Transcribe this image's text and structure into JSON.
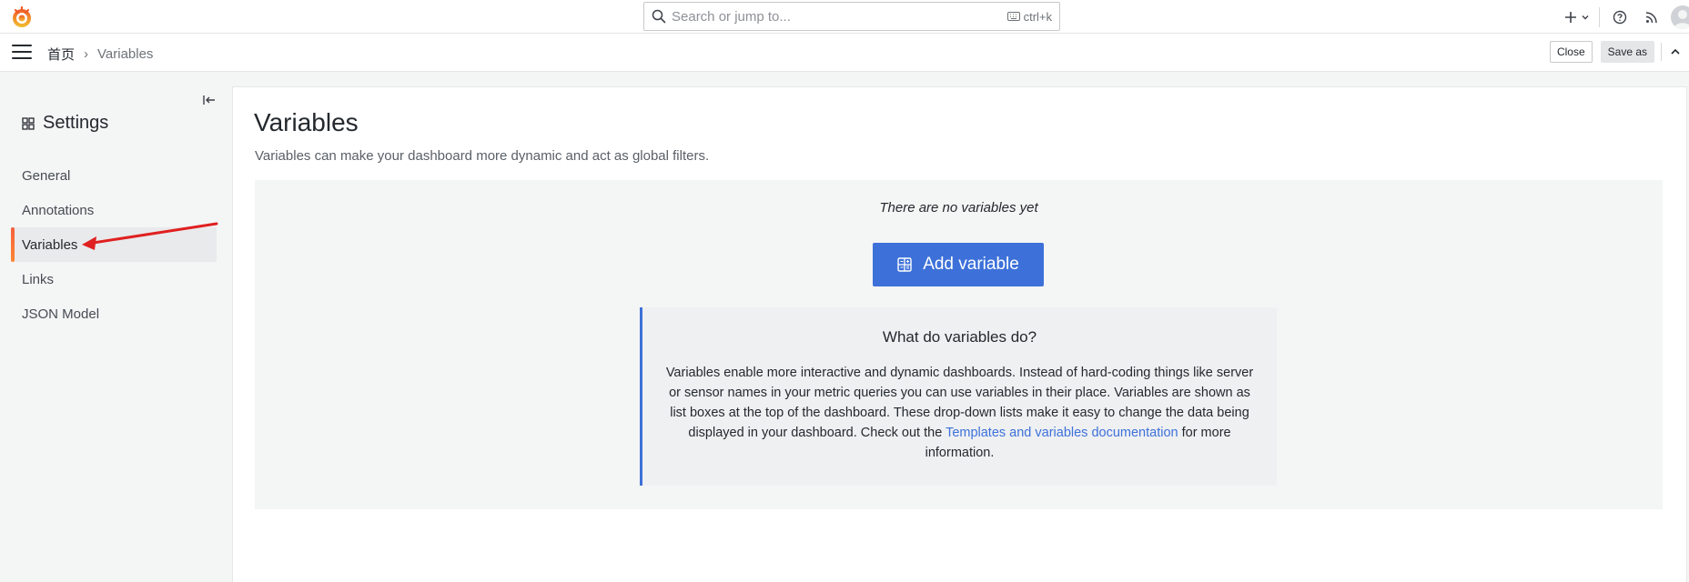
{
  "topbar": {
    "search_placeholder": "Search or jump to...",
    "search_shortcut": "ctrl+k"
  },
  "subbar": {
    "breadcrumb_home": "首页",
    "breadcrumb_sep": "›",
    "breadcrumb_current": "Variables",
    "close_label": "Close",
    "save_as_label": "Save as"
  },
  "sidebar": {
    "title": "Settings",
    "items": [
      {
        "label": "General"
      },
      {
        "label": "Annotations"
      },
      {
        "label": "Variables"
      },
      {
        "label": "Links"
      },
      {
        "label": "JSON Model"
      }
    ]
  },
  "main": {
    "title": "Variables",
    "subtitle": "Variables can make your dashboard more dynamic and act as global filters.",
    "empty_message": "There are no variables yet",
    "add_button": "Add variable",
    "info": {
      "title": "What do variables do?",
      "text": "Variables enable more interactive and dynamic dashboards. Instead of hard-coding things like server or sensor names in your metric queries you can use variables in their place. Variables are shown as list boxes at the top of the dashboard. These drop-down lists make it easy to change the data being displayed in your dashboard. Check out the",
      "link": "Templates and variables documentation",
      "text_after": "for more information."
    }
  },
  "colors": {
    "primary": "#3d71d9",
    "active_bar": "#f55f3e",
    "annotation_arrow": "#e02020"
  }
}
